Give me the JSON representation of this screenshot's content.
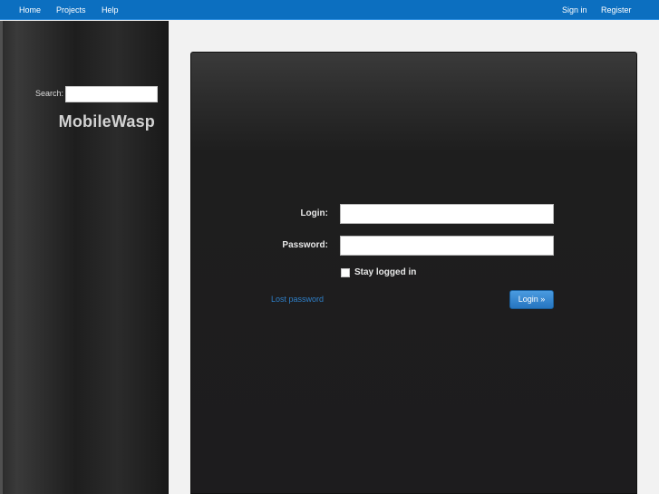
{
  "topnav": {
    "left": [
      {
        "label": "Home"
      },
      {
        "label": "Projects"
      },
      {
        "label": "Help"
      }
    ],
    "right": [
      {
        "label": "Sign in"
      },
      {
        "label": "Register"
      }
    ]
  },
  "sidebar": {
    "search_label": "Search:",
    "search_value": "",
    "site_title": "MobileWasp"
  },
  "login_form": {
    "login_label": "Login:",
    "login_value": "",
    "password_label": "Password:",
    "password_value": "",
    "remember_label": "Stay logged in",
    "remember_checked": false,
    "lost_password_label": "Lost password",
    "submit_label": "Login »"
  },
  "colors": {
    "topbar": "#0c6fc0",
    "link": "#2f7fc8",
    "button": "#2675c0"
  }
}
